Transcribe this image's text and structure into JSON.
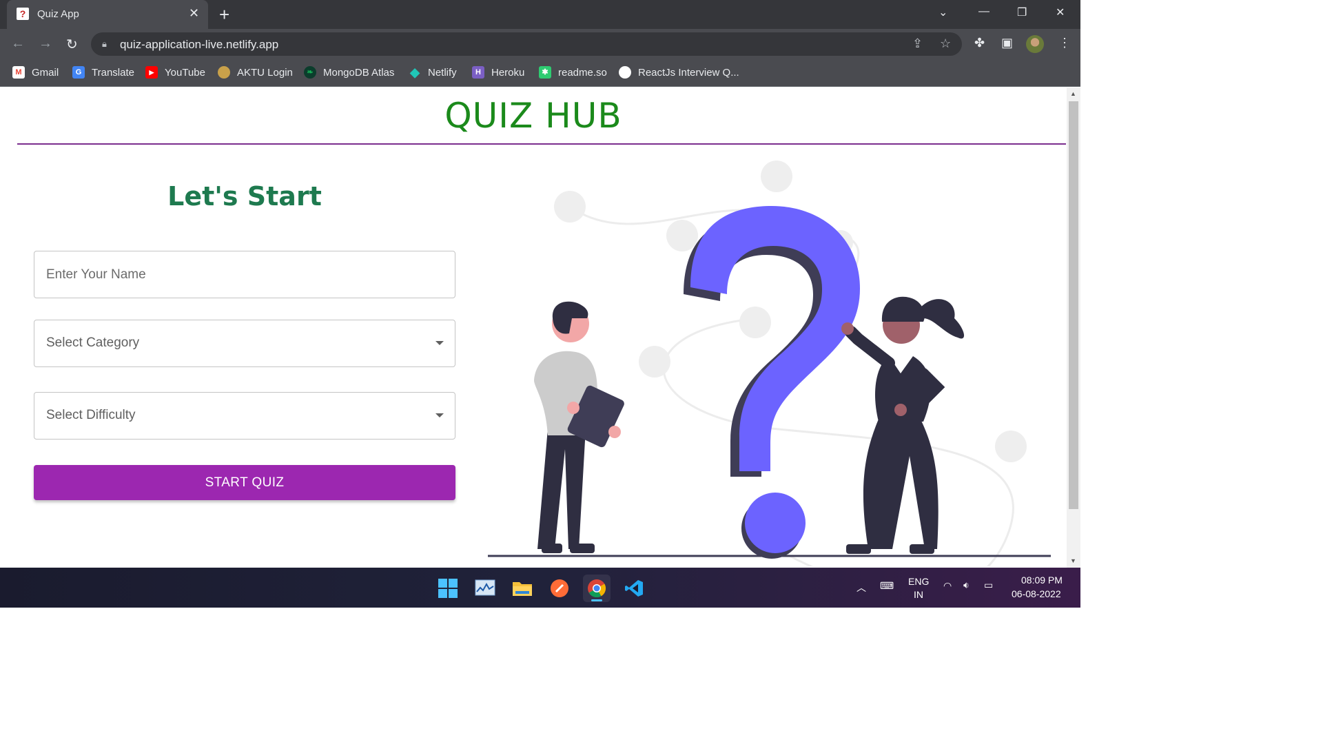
{
  "browser": {
    "tab_title": "Quiz App",
    "tab_favicon": "?",
    "url": "quiz-application-live.netlify.app",
    "bookmarks": [
      {
        "label": "Gmail",
        "icon": "gmail-icon",
        "color": "#ea4335",
        "glyph": "M"
      },
      {
        "label": "Translate",
        "icon": "translate-icon",
        "color": "#4285f4",
        "glyph": "G"
      },
      {
        "label": "YouTube",
        "icon": "youtube-icon",
        "color": "#ff0000",
        "glyph": "▶"
      },
      {
        "label": "AKTU Login",
        "icon": "aktu-icon",
        "color": "#c9a14a",
        "glyph": "●"
      },
      {
        "label": "MongoDB Atlas",
        "icon": "mongodb-icon",
        "color": "#13aa52",
        "glyph": "❧"
      },
      {
        "label": "Netlify",
        "icon": "netlify-icon",
        "color": "#20c6b7",
        "glyph": "◆"
      },
      {
        "label": "Heroku",
        "icon": "heroku-icon",
        "color": "#7b5fc4",
        "glyph": "H"
      },
      {
        "label": "readme.so",
        "icon": "readme-icon",
        "color": "#2ecc71",
        "glyph": "✱"
      },
      {
        "label": "ReactJs Interview Q...",
        "icon": "github-icon",
        "color": "#ffffff",
        "glyph": "●"
      }
    ]
  },
  "page": {
    "title": "QUIZ HUB",
    "heading": "Let's Start",
    "name_placeholder": "Enter Your Name",
    "category_label": "Select Category",
    "difficulty_label": "Select Difficulty",
    "start_button": "START QUIZ"
  },
  "taskbar": {
    "language_line1": "ENG",
    "language_line2": "IN",
    "time": "08:09 PM",
    "date": "06-08-2022"
  },
  "colors": {
    "title_green": "#1b8a1b",
    "heading_green": "#1e7a4f",
    "button_purple": "#9c27b0",
    "question_mark": "#6c63ff",
    "rule_purple": "#7b2d8e"
  }
}
